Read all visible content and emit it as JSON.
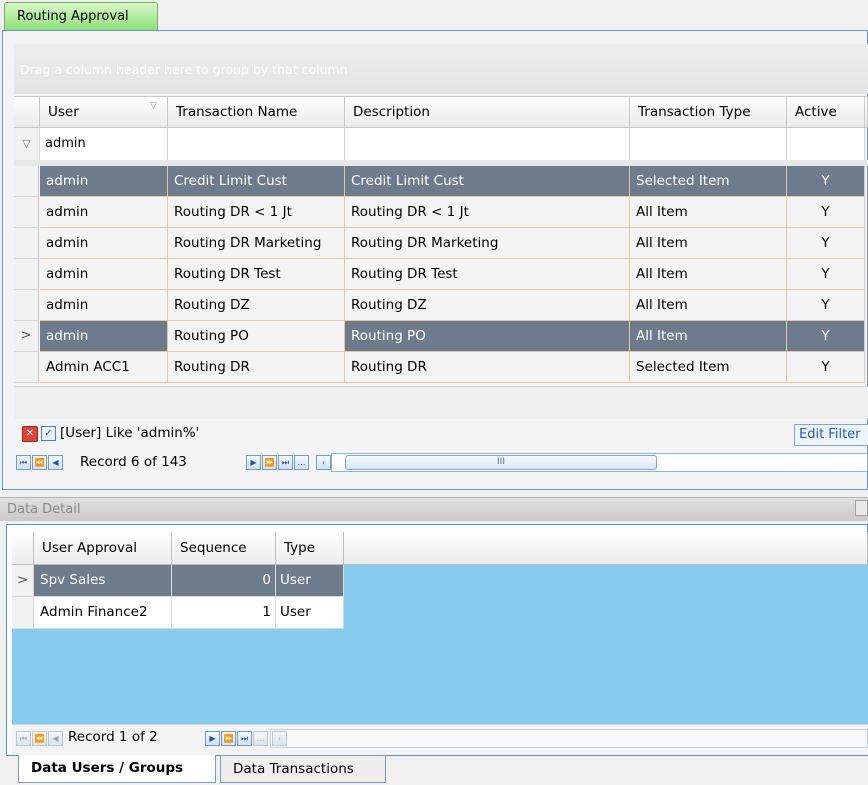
{
  "window": {
    "tab_label": "Routing Approval"
  },
  "group_panel": {
    "hint": "Drag a column header here to group by that column"
  },
  "grid": {
    "columns": [
      "User",
      "Transaction Name",
      "Description",
      "Transaction Type",
      "Active"
    ],
    "filter_row": {
      "user": "admin"
    },
    "rows": [
      {
        "user": "admin",
        "transaction_name": "Credit Limit Cust",
        "description": "Credit Limit Cust",
        "transaction_type": "Selected Item",
        "active": "Y"
      },
      {
        "user": "admin",
        "transaction_name": "Routing DR < 1 Jt",
        "description": "Routing DR < 1 Jt",
        "transaction_type": "All Item",
        "active": "Y"
      },
      {
        "user": "admin",
        "transaction_name": "Routing DR Marketing",
        "description": "Routing DR Marketing",
        "transaction_type": "All Item",
        "active": "Y"
      },
      {
        "user": "admin",
        "transaction_name": "Routing DR Test",
        "description": "Routing DR Test",
        "transaction_type": "All Item",
        "active": "Y"
      },
      {
        "user": "admin",
        "transaction_name": "Routing DZ",
        "description": "Routing DZ",
        "transaction_type": "All Item",
        "active": "Y"
      },
      {
        "user": "admin",
        "transaction_name": "Routing PO",
        "description": "Routing PO",
        "transaction_type": "All Item",
        "active": "Y"
      },
      {
        "user": "Admin ACC1",
        "transaction_name": "Routing DR",
        "description": "Routing DR",
        "transaction_type": "Selected Item",
        "active": "Y"
      }
    ],
    "filter_text": "[User] Like 'admin%'",
    "edit_filter_label": "Edit Filter",
    "record_text": "Record 6 of 143",
    "scroll_glyph": "III"
  },
  "detail": {
    "title": "Data Detail",
    "columns": [
      "User Approval",
      "Sequence",
      "Type"
    ],
    "rows": [
      {
        "user_approval": "Spv Sales",
        "sequence": "0",
        "type": "User"
      },
      {
        "user_approval": "Admin Finance2",
        "sequence": "1",
        "type": "User"
      }
    ],
    "record_text": "Record 1 of 2"
  },
  "bottom_tabs": [
    "Data Users / Groups",
    "Data Transactions"
  ],
  "colors": {
    "selected_row": "#6d7b8d",
    "detail_background": "#87cbef",
    "active_tab": "#8fe07a"
  }
}
